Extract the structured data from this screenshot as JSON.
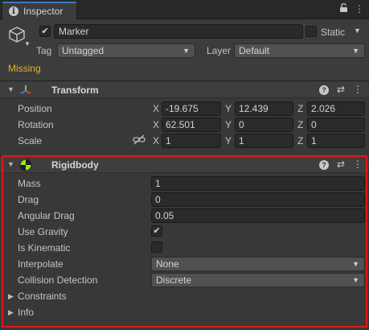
{
  "tab": {
    "icon": "info-icon",
    "label": "Inspector"
  },
  "tabbar_icons": {
    "lock": "🔒",
    "menu": "⋮"
  },
  "object": {
    "name": "Marker",
    "active": true,
    "static_label": "Static",
    "static_checked": false,
    "tag_label": "Tag",
    "tag_value": "Untagged",
    "layer_label": "Layer",
    "layer_value": "Default",
    "warning": "Missing"
  },
  "transform": {
    "title": "Transform",
    "rows": [
      {
        "label": "Position",
        "x": "-19.675",
        "y": "12.439",
        "z": "2.026"
      },
      {
        "label": "Rotation",
        "x": "62.501",
        "y": "0",
        "z": "0"
      },
      {
        "label": "Scale",
        "x": "1",
        "y": "1",
        "z": "1"
      }
    ],
    "axes": {
      "x": "X",
      "y": "Y",
      "z": "Z"
    }
  },
  "rigidbody": {
    "title": "Rigidbody",
    "mass_label": "Mass",
    "mass": "1",
    "drag_label": "Drag",
    "drag": "0",
    "angular_drag_label": "Angular Drag",
    "angular_drag": "0.05",
    "use_gravity_label": "Use Gravity",
    "use_gravity": true,
    "is_kinematic_label": "Is Kinematic",
    "is_kinematic": false,
    "interpolate_label": "Interpolate",
    "interpolate": "None",
    "collision_label": "Collision Detection",
    "collision": "Discrete",
    "constraints_label": "Constraints",
    "info_label": "Info"
  },
  "glyphs": {
    "check": "✔",
    "fold_open": "▼",
    "fold_closed": "▶",
    "dd_arrow": "▼",
    "settings": "⇄",
    "more": "⋮",
    "help": "?"
  },
  "colors": {
    "accent": "#3a79bb",
    "warning": "#e1b32c",
    "highlight": "#e01818"
  }
}
